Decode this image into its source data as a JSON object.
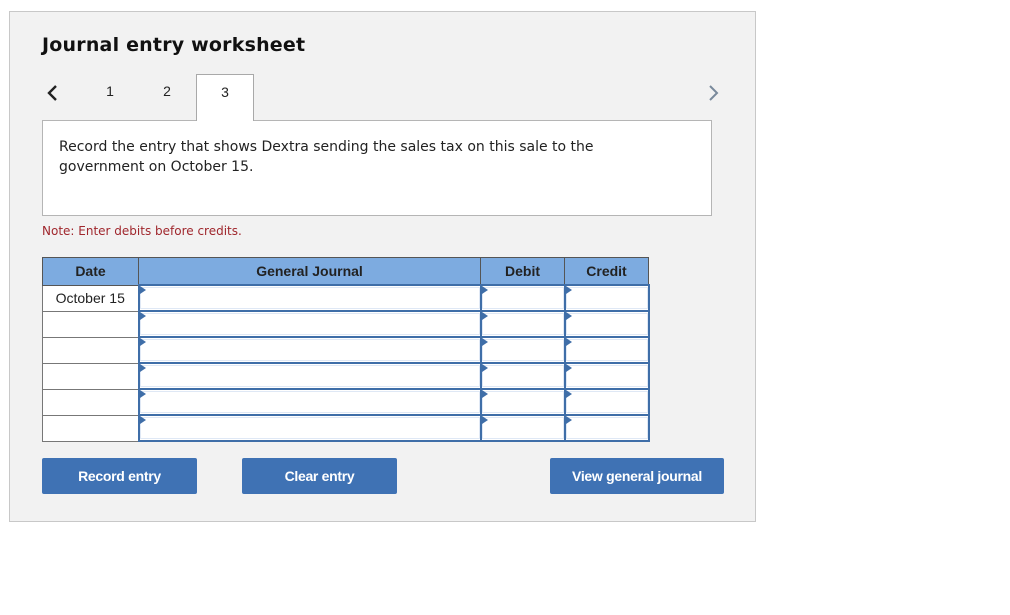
{
  "header": {
    "title": "Journal entry worksheet"
  },
  "pager": {
    "prev_icon": "chevron-left-icon",
    "next_icon": "chevron-right-icon",
    "tabs": [
      {
        "label": "1",
        "active": false
      },
      {
        "label": "2",
        "active": false
      },
      {
        "label": "3",
        "active": true
      }
    ]
  },
  "prompt": {
    "text": "Record the entry that shows Dextra sending the sales tax on this sale to the government on October 15."
  },
  "note": "Note: Enter debits before credits.",
  "table": {
    "columns": [
      "Date",
      "General Journal",
      "Debit",
      "Credit"
    ],
    "rows": [
      {
        "date": "October 15",
        "account": "",
        "debit": "",
        "credit": ""
      },
      {
        "date": "",
        "account": "",
        "debit": "",
        "credit": ""
      },
      {
        "date": "",
        "account": "",
        "debit": "",
        "credit": ""
      },
      {
        "date": "",
        "account": "",
        "debit": "",
        "credit": ""
      },
      {
        "date": "",
        "account": "",
        "debit": "",
        "credit": ""
      },
      {
        "date": "",
        "account": "",
        "debit": "",
        "credit": ""
      }
    ]
  },
  "buttons": {
    "record": "Record entry",
    "clear": "Clear entry",
    "view": "View general journal"
  },
  "colors": {
    "header_bg": "#7dabe0",
    "button_bg": "#3f72b4",
    "input_border": "#3f6ea8",
    "note_text": "#a0272d"
  }
}
